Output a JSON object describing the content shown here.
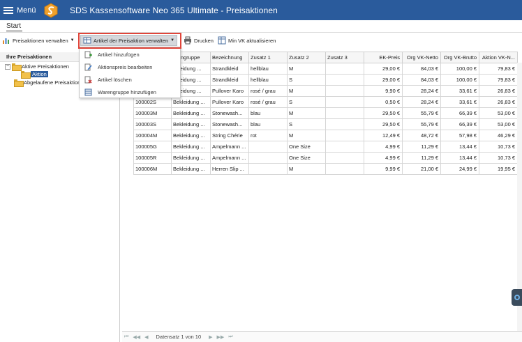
{
  "titlebar": {
    "menu_label": "Menü",
    "title": "SDS Kassensoftware Neo 365 Ultimate - Preisaktionen",
    "bg": "#2a5b9c"
  },
  "ribbon": {
    "tab": "Start",
    "buttons": {
      "preisaktionen": "Preisaktionen verwalten",
      "artikel": "Artikel der Preisaktion verwalten",
      "drucken": "Drucken",
      "vk": "Min VK aktualisieren"
    }
  },
  "dropdown": {
    "items": [
      {
        "label": "Artikel hinzufügen",
        "icon": "add-document-icon"
      },
      {
        "label": "Aktionspreis bearbeiten",
        "icon": "edit-icon"
      },
      {
        "label": "Artikel löschen",
        "icon": "delete-icon"
      },
      {
        "label": "Warengruppe hinzufügen",
        "icon": "group-icon"
      }
    ]
  },
  "tree": {
    "header": "Ihre Preisaktionen",
    "active": "Aktive Preisaktionen",
    "child": "Aktion",
    "expired": "Abgelaufene Preisaktionen",
    "expired_visible": "Abgelaufene Preisaktion"
  },
  "grid": {
    "columns": [
      "",
      "arengruppe",
      "Bezeichnung",
      "Zusatz 1",
      "Zusatz 2",
      "Zusatz 3",
      "EK-Preis",
      "Org VK-Netto",
      "Org VK-Brutto",
      "Aktion VK-N..."
    ],
    "rows": [
      [
        "",
        "ekleidung ...",
        "Strandkleid",
        "hellblau",
        "M",
        "",
        "29,00 €",
        "84,03 €",
        "100,00 €",
        "79,83 €"
      ],
      [
        "",
        "ekleidung ...",
        "Strandkleid",
        "hellblau",
        "S",
        "",
        "29,00 €",
        "84,03 €",
        "100,00 €",
        "79,83 €"
      ],
      [
        "",
        "ekleidung ...",
        "Pullover Karo",
        "rosé / grau",
        "M",
        "",
        "9,90 €",
        "28,24 €",
        "33,61 €",
        "26,83 €"
      ],
      [
        "100002S",
        "Bekleidung ...",
        "Pullover Karo",
        "rosé / grau",
        "S",
        "",
        "0,50 €",
        "28,24 €",
        "33,61 €",
        "26,83 €"
      ],
      [
        "100003M",
        "Bekleidung ...",
        "Stonewash...",
        "blau",
        "M",
        "",
        "29,50 €",
        "55,79 €",
        "66,39 €",
        "53,00 €"
      ],
      [
        "100003S",
        "Bekleidung ...",
        "Stonewash...",
        "blau",
        "S",
        "",
        "29,50 €",
        "55,79 €",
        "66,39 €",
        "53,00 €"
      ],
      [
        "100004M",
        "Bekleidung ...",
        "String Chérie",
        "rot",
        "M",
        "",
        "12,49 €",
        "48,72 €",
        "57,98 €",
        "46,29 €"
      ],
      [
        "100005G",
        "Bekleidung ...",
        "Ampelmann ...",
        "",
        "One Size",
        "",
        "4,99 €",
        "11,29 €",
        "13,44 €",
        "10,73 €"
      ],
      [
        "100005R",
        "Bekleidung ...",
        "Ampelmann ...",
        "",
        "One Size",
        "",
        "4,99 €",
        "11,29 €",
        "13,44 €",
        "10,73 €"
      ],
      [
        "100006M",
        "Bekleidung ...",
        "Herren Slip ...",
        "",
        "M",
        "",
        "9,99 €",
        "21,00 €",
        "24,99 €",
        "19,95 €"
      ]
    ]
  },
  "pager": {
    "text": "Datensatz 1 von 10"
  },
  "colors": {
    "highlight": "#e0453a",
    "selection": "#2a5b9c"
  }
}
